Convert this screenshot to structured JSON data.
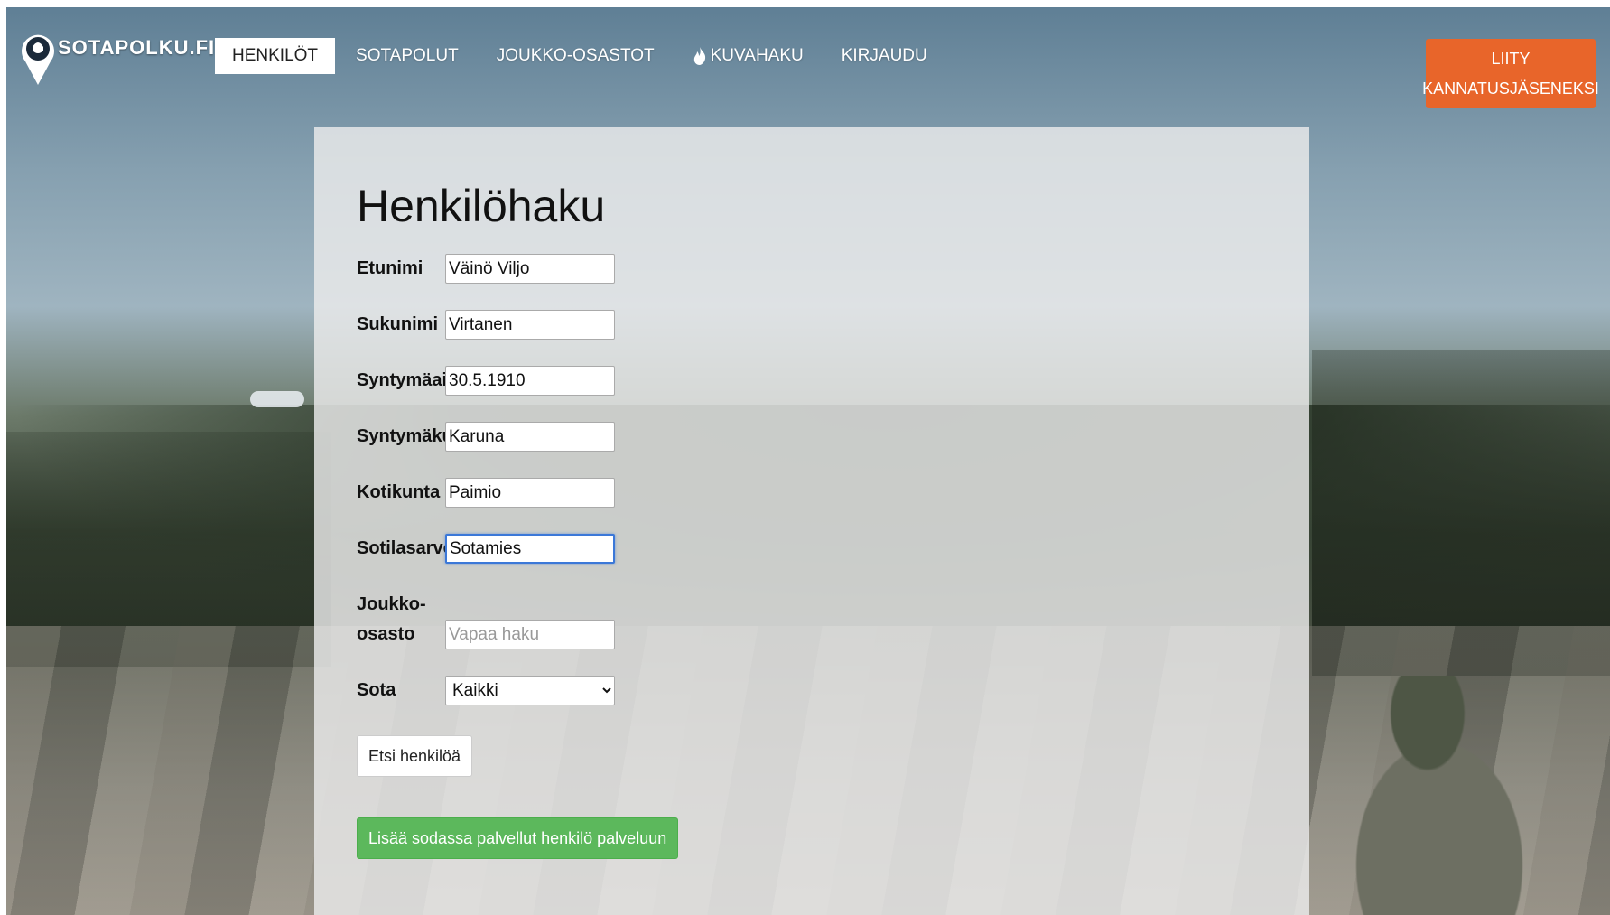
{
  "logo": {
    "text": "SOTAPOLKU.FI"
  },
  "nav": {
    "items": [
      {
        "label": "HENKILÖT",
        "active": true
      },
      {
        "label": "SOTAPOLUT"
      },
      {
        "label": "JOUKKO-OSASTOT"
      },
      {
        "label": "KUVAHAKU",
        "icon": "fire-icon"
      },
      {
        "label": "KIRJAUDU"
      }
    ],
    "join_line1": "LIITY",
    "join_line2": "KANNATUSJÄSENEKSI"
  },
  "form": {
    "title": "Henkilöhaku",
    "fields": {
      "etunimi": {
        "label": "Etunimi",
        "value": "Väinö Viljo"
      },
      "sukunimi": {
        "label": "Sukunimi",
        "value": "Virtanen"
      },
      "syntymaaika": {
        "label": "Syntymäaika",
        "value": "30.5.1910"
      },
      "syntymakunta": {
        "label": "Syntymäkunta",
        "value": "Karuna"
      },
      "kotikunta": {
        "label": "Kotikunta",
        "value": "Paimio"
      },
      "sotilasarvo": {
        "label": "Sotilasarvo",
        "value": "Sotamies"
      },
      "joukko_osasto": {
        "label": "Joukko-osasto",
        "value": "",
        "placeholder": "Vapaa haku"
      },
      "sota": {
        "label": "Sota",
        "selected": "Kaikki"
      }
    },
    "search_button": "Etsi henkilöä",
    "add_button": "Lisää sodassa palvellut henkilö palveluun"
  },
  "colors": {
    "accent_orange": "#e8652a",
    "success_green": "#5cb85c",
    "focus_blue": "#3b78d8"
  }
}
